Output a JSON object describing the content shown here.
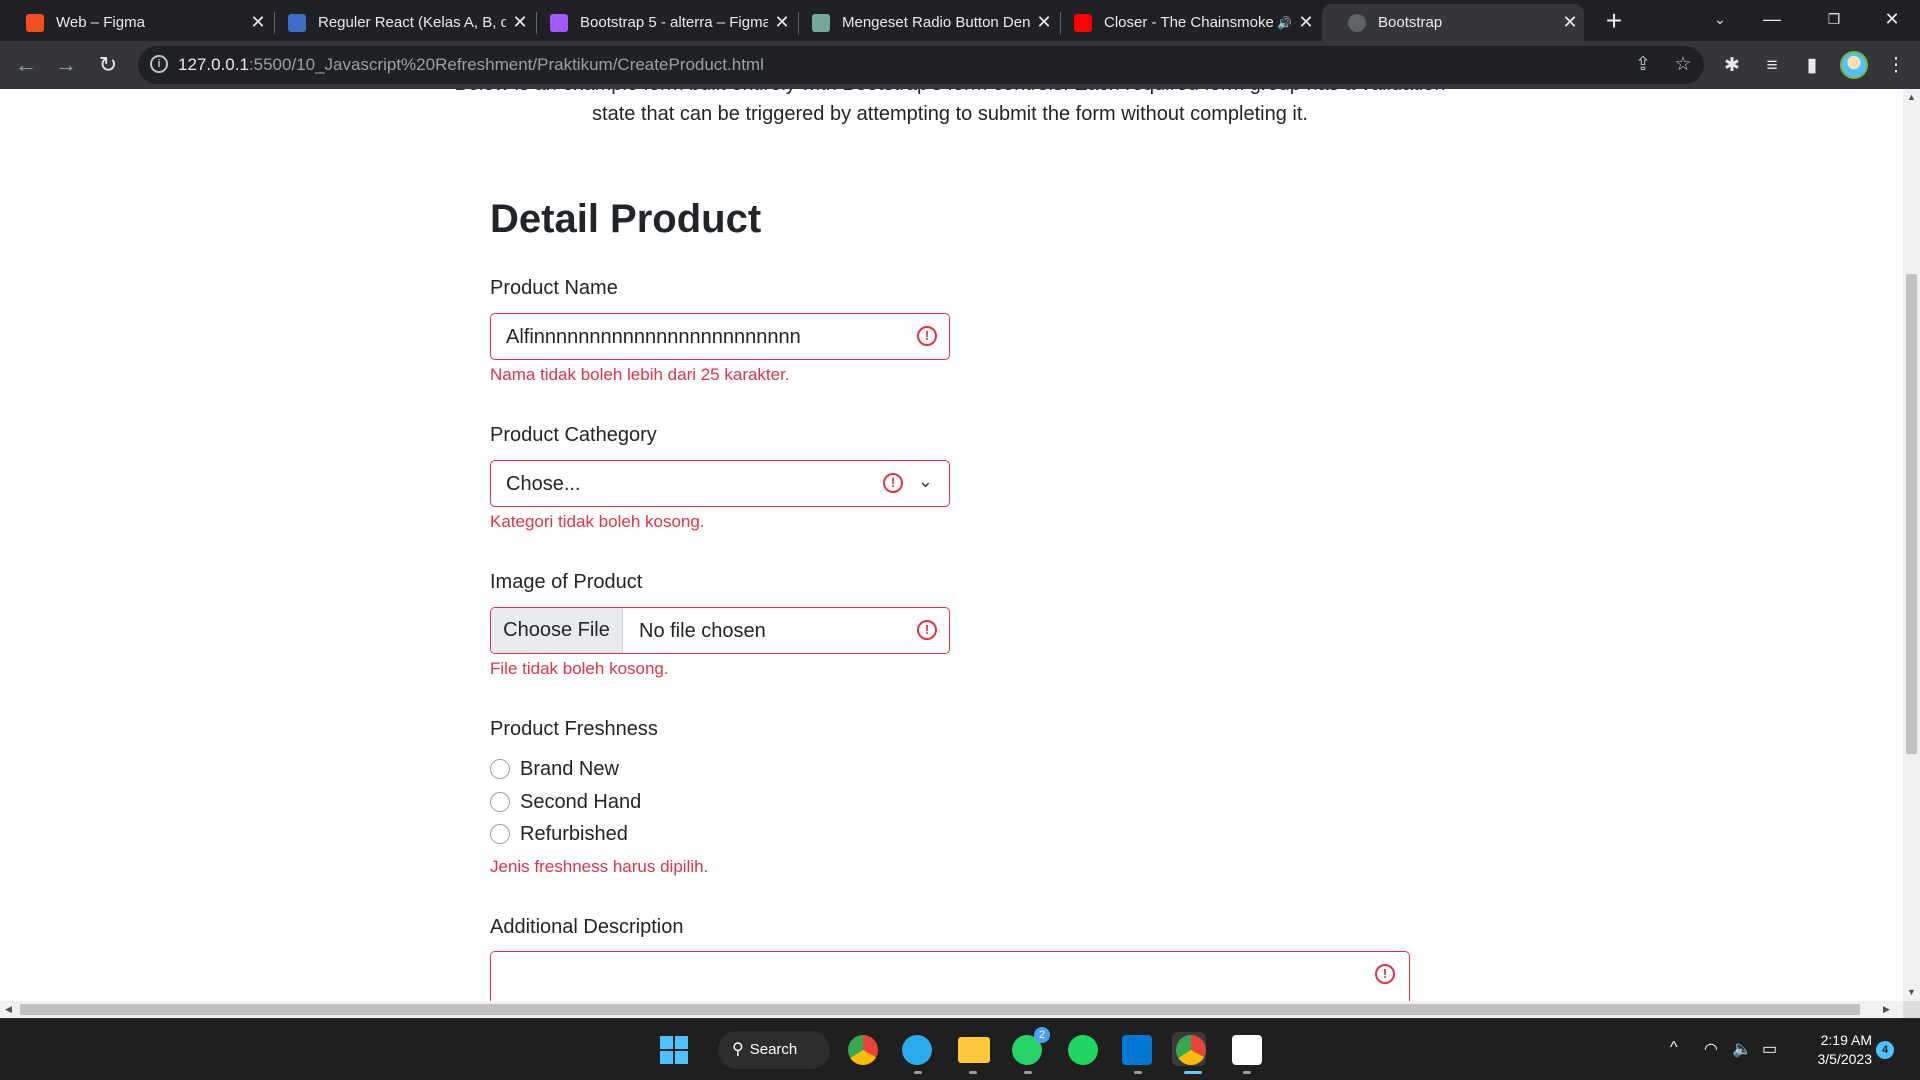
{
  "browser": {
    "tabs": [
      {
        "title": "Web – Figma",
        "favicon": "figma-icon",
        "color": "#f24e1e"
      },
      {
        "title": "Reguler React (Kelas A, B, dan C)",
        "favicon": "alterra-icon",
        "color": "#3d6dc9"
      },
      {
        "title": "Bootstrap 5 - alterra – Figma",
        "favicon": "figma-icon",
        "color": "#a259ff"
      },
      {
        "title": "Mengeset Radio Button Dengan",
        "favicon": "chatgpt-icon",
        "color": "#74aa9c"
      },
      {
        "title": "Closer - The Chainsmokers",
        "favicon": "youtube-icon",
        "color": "#ff0000"
      },
      {
        "title": "Bootstrap",
        "favicon": "globe-icon",
        "color": "#9aa0a6"
      }
    ],
    "active_tab_index": 5,
    "url_host": "127.0.0.1",
    "url_path": ":5500/10_Javascript%20Refreshment/Praktikum/CreateProduct.html"
  },
  "page": {
    "intro_text": "Below is an example form built entirely with Bootstrap's form controls. Each required form group has a validation state that can be triggered by attempting to submit the form without completing it.",
    "heading": "Detail Product",
    "product_name": {
      "label": "Product Name",
      "value": "Alfinnnnnnnnnnnnnnnnnnnnnnnn",
      "error": "Nama tidak boleh lebih dari 25 karakter."
    },
    "category": {
      "label": "Product Cathegory",
      "selected": "Chose...",
      "error": "Kategori tidak boleh kosong."
    },
    "image": {
      "label": "Image of Product",
      "button": "Choose File",
      "status": "No file chosen",
      "error": "File tidak boleh kosong."
    },
    "freshness": {
      "label": "Product Freshness",
      "options": [
        "Brand New",
        "Second Hand",
        "Refurbished"
      ],
      "error": "Jenis freshness harus dipilih."
    },
    "description": {
      "label": "Additional Description"
    },
    "error_color": "#dc3545"
  },
  "taskbar": {
    "search_label": "Search",
    "whatsapp_badge": "2",
    "time": "2:19 AM",
    "date": "3/5/2023",
    "notification_count": "4"
  }
}
